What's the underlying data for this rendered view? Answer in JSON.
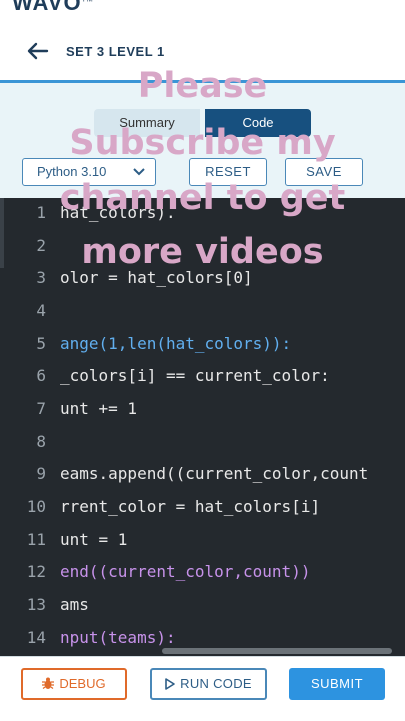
{
  "brand": {
    "name": "WAVO",
    "tm": "TM"
  },
  "header": {
    "title": "SET 3 LEVEL 1"
  },
  "tabs": {
    "summary": "Summary",
    "code": "Code"
  },
  "toolbar": {
    "language": "Python 3.10",
    "reset": "RESET",
    "save": "SAVE"
  },
  "editor": {
    "line_numbers": [
      "1",
      "2",
      "3",
      "4",
      "5",
      "6",
      "7",
      "8",
      "9",
      "10",
      "11",
      "12",
      "13",
      "14"
    ],
    "lines": [
      "hat_colors).",
      "",
      "olor = hat_colors[0]",
      "",
      "ange(1,len(hat_colors)):",
      "_colors[i] == current_color:",
      "unt += 1",
      "",
      "eams.append((current_color,count",
      "rrent_color = hat_colors[i]",
      "unt = 1",
      "end((current_color,count))",
      "ams",
      "nput(teams):"
    ]
  },
  "footer": {
    "debug": "DEBUG",
    "run_code": "RUN CODE",
    "submit": "SUBMIT"
  },
  "overlay_text": [
    "Please",
    "Subscribe my",
    "channel to get",
    "more videos"
  ],
  "colors": {
    "accent": "#17507f",
    "submit": "#2d93e0",
    "debug": "#e06a2a",
    "editor_bg": "#24292e"
  }
}
